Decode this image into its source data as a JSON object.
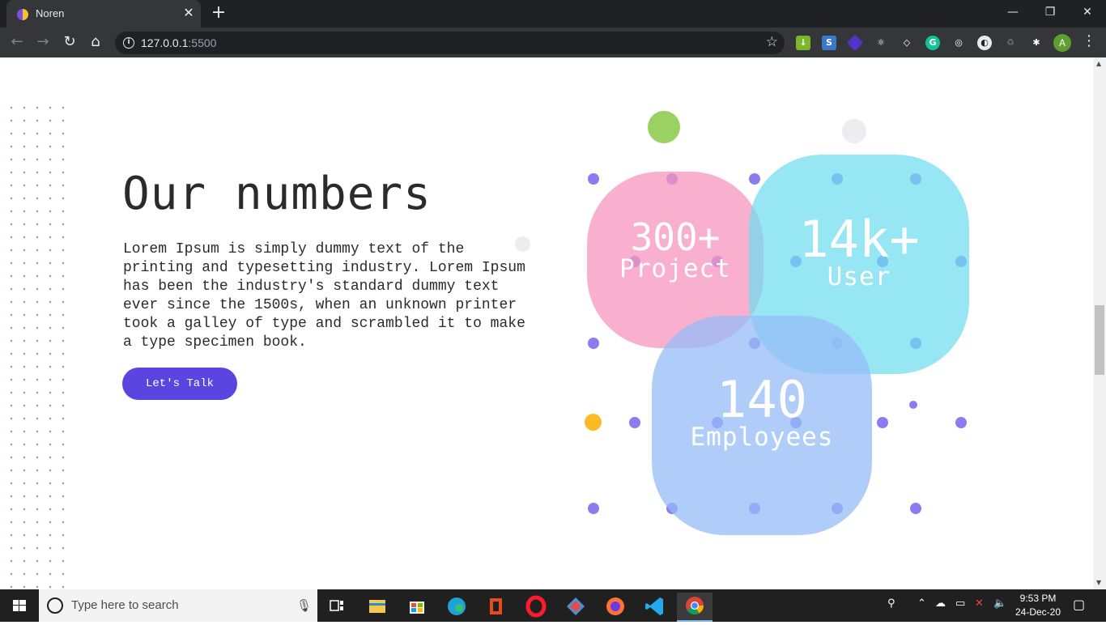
{
  "browser": {
    "tab_title": "Noren",
    "url_host": "127.0.0.1",
    "url_port": ":5500",
    "profile_initial": "A"
  },
  "page": {
    "heading": "Our numbers",
    "body": "Lorem Ipsum is simply dummy text of the printing and typesetting industry. Lorem Ipsum has been the industry's standard dummy text ever since the 1500s, when an unknown printer took a galley of type and scrambled it to make a type specimen book.",
    "cta_label": "Let's Talk",
    "stats": [
      {
        "value": "300+",
        "label": "Project",
        "color": "#f7a1c4"
      },
      {
        "value": "14k+",
        "label": "User",
        "color": "#7fe0f0"
      },
      {
        "value": "140",
        "label": "Employees",
        "color": "#a5c6f8"
      }
    ],
    "accent_color": "#5b45e0"
  },
  "taskbar": {
    "search_placeholder": "Type here to search",
    "time": "9:53 PM",
    "date": "24-Dec-20"
  }
}
